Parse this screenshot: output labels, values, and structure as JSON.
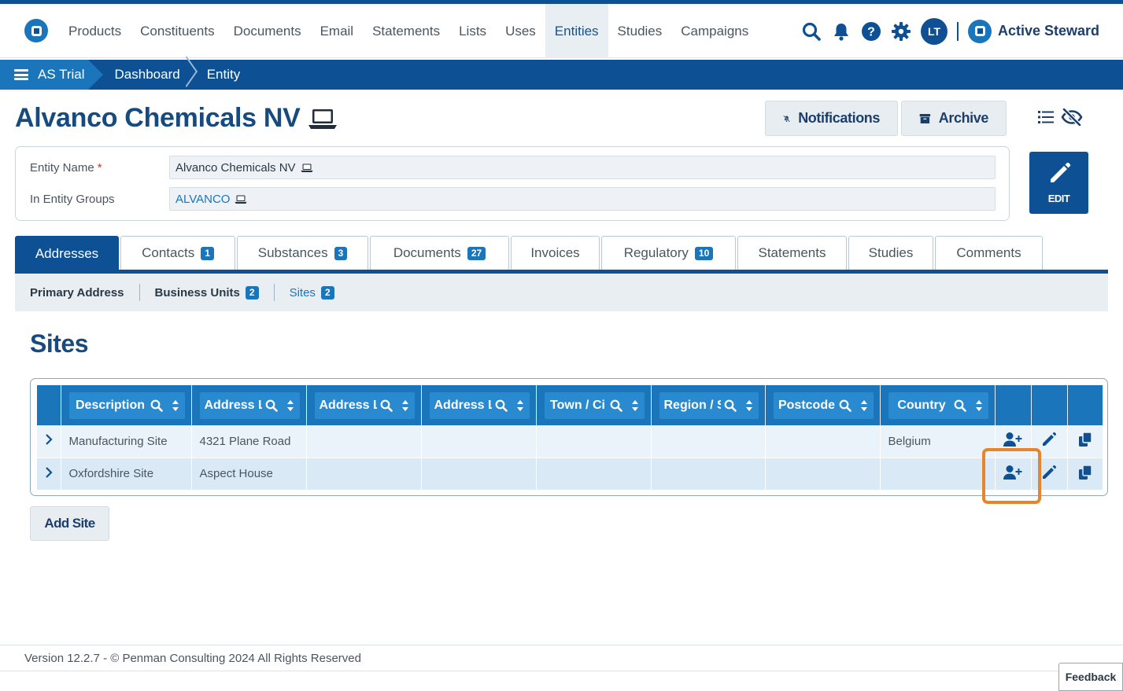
{
  "nav": {
    "links": [
      "Products",
      "Constituents",
      "Documents",
      "Email",
      "Statements",
      "Lists",
      "Uses",
      "Entities",
      "Studies",
      "Campaigns"
    ],
    "active": "Entities",
    "avatar_initials": "LT",
    "brand": "Active Steward"
  },
  "breadcrumb": {
    "items": [
      "AS Trial",
      "Dashboard",
      "Entity"
    ]
  },
  "page": {
    "title": "Alvanco Chemicals NV",
    "notifications_label": "Notifications",
    "archive_label": "Archive",
    "edit_label": "EDIT"
  },
  "form": {
    "entity_name_label": "Entity Name",
    "required_mark": "*",
    "entity_name_value": "Alvanco Chemicals NV",
    "groups_label": "In Entity Groups",
    "groups_value": "ALVANCO"
  },
  "tabs": [
    {
      "label": "Addresses",
      "badge": ""
    },
    {
      "label": "Contacts",
      "badge": "1"
    },
    {
      "label": "Substances",
      "badge": "3"
    },
    {
      "label": "Documents",
      "badge": "27"
    },
    {
      "label": "Invoices",
      "badge": ""
    },
    {
      "label": "Regulatory",
      "badge": "10"
    },
    {
      "label": "Statements",
      "badge": ""
    },
    {
      "label": "Studies",
      "badge": ""
    },
    {
      "label": "Comments",
      "badge": ""
    }
  ],
  "subtabs": [
    {
      "label": "Primary Address",
      "badge": ""
    },
    {
      "label": "Business Units",
      "badge": "2"
    },
    {
      "label": "Sites",
      "badge": "2"
    }
  ],
  "section": {
    "title": "Sites",
    "add_label": "Add Site"
  },
  "table": {
    "columns": [
      "Description",
      "Address L",
      "Address L",
      "Address L",
      "Town / Ci",
      "Region / S",
      "Postcode",
      "Country"
    ],
    "rows": [
      [
        "Manufacturing Site",
        "4321 Plane Road",
        "",
        "",
        "",
        "",
        "",
        "Belgium"
      ],
      [
        "Oxfordshire Site",
        "Aspect House",
        "",
        "",
        "",
        "",
        "",
        ""
      ]
    ]
  },
  "footer": {
    "version": "Version 12.2.7 - © Penman Consulting 2024 All Rights Reserved",
    "feedback": "Feedback"
  },
  "colors": {
    "primary": "#0d5194",
    "accent": "#1b75bb",
    "highlight": "#e8852c"
  }
}
